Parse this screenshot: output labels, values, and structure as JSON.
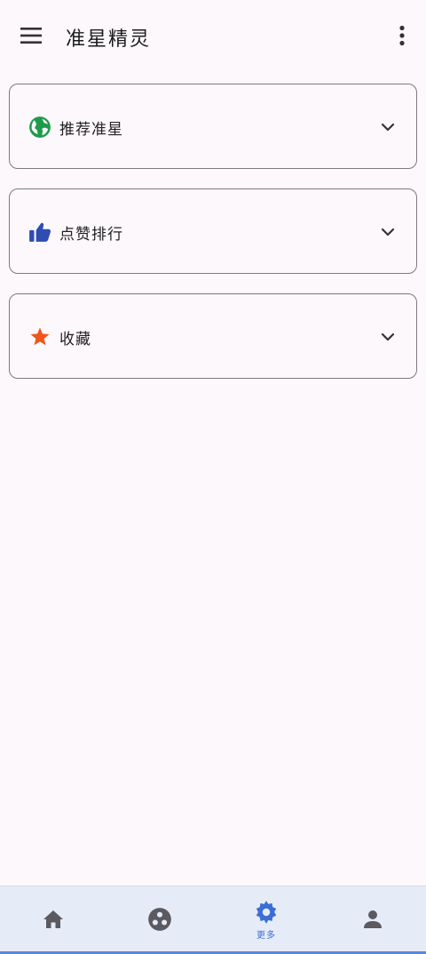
{
  "app_bar": {
    "title": "准星精灵",
    "menu_icon": "hamburger-menu-icon",
    "more_icon": "more-vertical-icon"
  },
  "sections": [
    {
      "label": "推荐准星",
      "icon": "globe-icon",
      "icon_color": "#1e9b4a"
    },
    {
      "label": "点赞排行",
      "icon": "thumbs-up-icon",
      "icon_color": "#2f4cb5"
    },
    {
      "label": "收藏",
      "icon": "star-icon",
      "icon_color": "#f0561c"
    }
  ],
  "bottom_nav": {
    "items": [
      {
        "icon": "home-icon",
        "label": "",
        "active": false
      },
      {
        "icon": "community-icon",
        "label": "",
        "active": false
      },
      {
        "icon": "settings-gear-icon",
        "label": "更多",
        "active": true
      },
      {
        "icon": "person-icon",
        "label": "",
        "active": false
      }
    ],
    "active_color": "#3b6fd4",
    "inactive_color": "#5a5a60"
  }
}
